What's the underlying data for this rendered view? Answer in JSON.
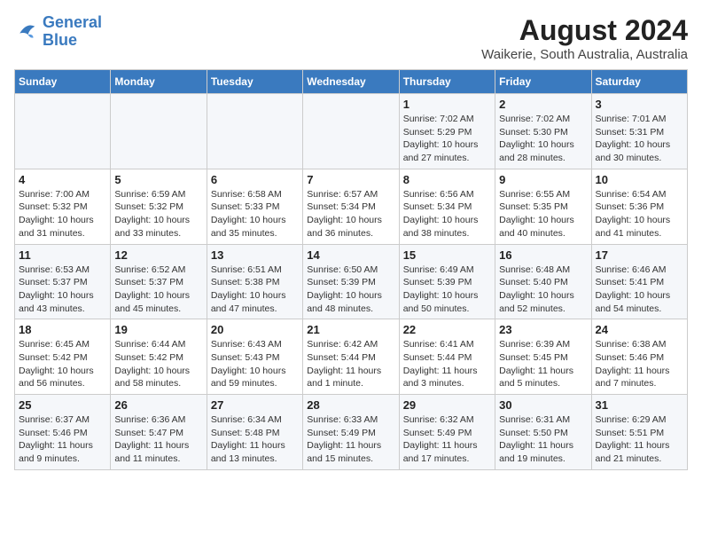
{
  "header": {
    "logo_line1": "General",
    "logo_line2": "Blue",
    "title": "August 2024",
    "subtitle": "Waikerie, South Australia, Australia"
  },
  "columns": [
    "Sunday",
    "Monday",
    "Tuesday",
    "Wednesday",
    "Thursday",
    "Friday",
    "Saturday"
  ],
  "weeks": [
    [
      {
        "day": "",
        "info": ""
      },
      {
        "day": "",
        "info": ""
      },
      {
        "day": "",
        "info": ""
      },
      {
        "day": "",
        "info": ""
      },
      {
        "day": "1",
        "info": "Sunrise: 7:02 AM\nSunset: 5:29 PM\nDaylight: 10 hours\nand 27 minutes."
      },
      {
        "day": "2",
        "info": "Sunrise: 7:02 AM\nSunset: 5:30 PM\nDaylight: 10 hours\nand 28 minutes."
      },
      {
        "day": "3",
        "info": "Sunrise: 7:01 AM\nSunset: 5:31 PM\nDaylight: 10 hours\nand 30 minutes."
      }
    ],
    [
      {
        "day": "4",
        "info": "Sunrise: 7:00 AM\nSunset: 5:32 PM\nDaylight: 10 hours\nand 31 minutes."
      },
      {
        "day": "5",
        "info": "Sunrise: 6:59 AM\nSunset: 5:32 PM\nDaylight: 10 hours\nand 33 minutes."
      },
      {
        "day": "6",
        "info": "Sunrise: 6:58 AM\nSunset: 5:33 PM\nDaylight: 10 hours\nand 35 minutes."
      },
      {
        "day": "7",
        "info": "Sunrise: 6:57 AM\nSunset: 5:34 PM\nDaylight: 10 hours\nand 36 minutes."
      },
      {
        "day": "8",
        "info": "Sunrise: 6:56 AM\nSunset: 5:34 PM\nDaylight: 10 hours\nand 38 minutes."
      },
      {
        "day": "9",
        "info": "Sunrise: 6:55 AM\nSunset: 5:35 PM\nDaylight: 10 hours\nand 40 minutes."
      },
      {
        "day": "10",
        "info": "Sunrise: 6:54 AM\nSunset: 5:36 PM\nDaylight: 10 hours\nand 41 minutes."
      }
    ],
    [
      {
        "day": "11",
        "info": "Sunrise: 6:53 AM\nSunset: 5:37 PM\nDaylight: 10 hours\nand 43 minutes."
      },
      {
        "day": "12",
        "info": "Sunrise: 6:52 AM\nSunset: 5:37 PM\nDaylight: 10 hours\nand 45 minutes."
      },
      {
        "day": "13",
        "info": "Sunrise: 6:51 AM\nSunset: 5:38 PM\nDaylight: 10 hours\nand 47 minutes."
      },
      {
        "day": "14",
        "info": "Sunrise: 6:50 AM\nSunset: 5:39 PM\nDaylight: 10 hours\nand 48 minutes."
      },
      {
        "day": "15",
        "info": "Sunrise: 6:49 AM\nSunset: 5:39 PM\nDaylight: 10 hours\nand 50 minutes."
      },
      {
        "day": "16",
        "info": "Sunrise: 6:48 AM\nSunset: 5:40 PM\nDaylight: 10 hours\nand 52 minutes."
      },
      {
        "day": "17",
        "info": "Sunrise: 6:46 AM\nSunset: 5:41 PM\nDaylight: 10 hours\nand 54 minutes."
      }
    ],
    [
      {
        "day": "18",
        "info": "Sunrise: 6:45 AM\nSunset: 5:42 PM\nDaylight: 10 hours\nand 56 minutes."
      },
      {
        "day": "19",
        "info": "Sunrise: 6:44 AM\nSunset: 5:42 PM\nDaylight: 10 hours\nand 58 minutes."
      },
      {
        "day": "20",
        "info": "Sunrise: 6:43 AM\nSunset: 5:43 PM\nDaylight: 10 hours\nand 59 minutes."
      },
      {
        "day": "21",
        "info": "Sunrise: 6:42 AM\nSunset: 5:44 PM\nDaylight: 11 hours\nand 1 minute."
      },
      {
        "day": "22",
        "info": "Sunrise: 6:41 AM\nSunset: 5:44 PM\nDaylight: 11 hours\nand 3 minutes."
      },
      {
        "day": "23",
        "info": "Sunrise: 6:39 AM\nSunset: 5:45 PM\nDaylight: 11 hours\nand 5 minutes."
      },
      {
        "day": "24",
        "info": "Sunrise: 6:38 AM\nSunset: 5:46 PM\nDaylight: 11 hours\nand 7 minutes."
      }
    ],
    [
      {
        "day": "25",
        "info": "Sunrise: 6:37 AM\nSunset: 5:46 PM\nDaylight: 11 hours\nand 9 minutes."
      },
      {
        "day": "26",
        "info": "Sunrise: 6:36 AM\nSunset: 5:47 PM\nDaylight: 11 hours\nand 11 minutes."
      },
      {
        "day": "27",
        "info": "Sunrise: 6:34 AM\nSunset: 5:48 PM\nDaylight: 11 hours\nand 13 minutes."
      },
      {
        "day": "28",
        "info": "Sunrise: 6:33 AM\nSunset: 5:49 PM\nDaylight: 11 hours\nand 15 minutes."
      },
      {
        "day": "29",
        "info": "Sunrise: 6:32 AM\nSunset: 5:49 PM\nDaylight: 11 hours\nand 17 minutes."
      },
      {
        "day": "30",
        "info": "Sunrise: 6:31 AM\nSunset: 5:50 PM\nDaylight: 11 hours\nand 19 minutes."
      },
      {
        "day": "31",
        "info": "Sunrise: 6:29 AM\nSunset: 5:51 PM\nDaylight: 11 hours\nand 21 minutes."
      }
    ]
  ]
}
